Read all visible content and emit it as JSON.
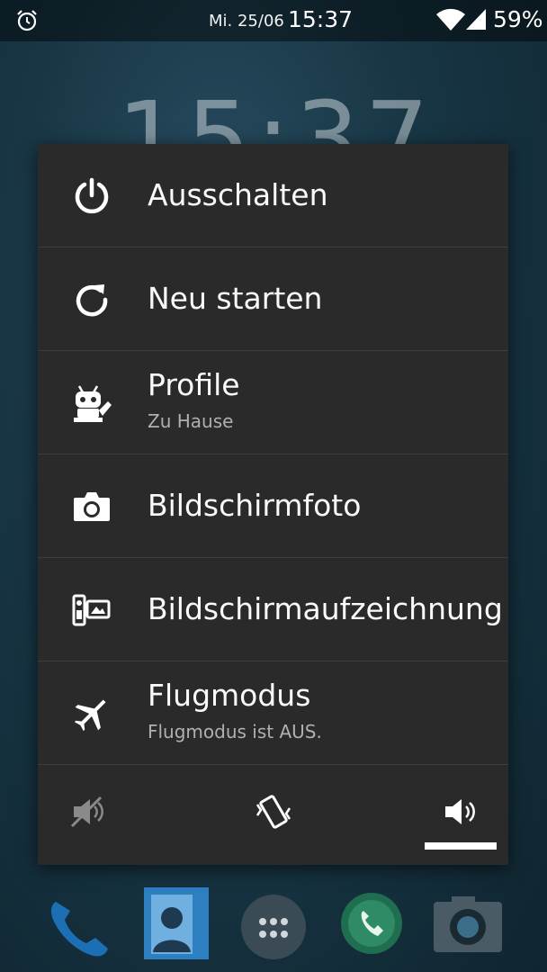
{
  "status_bar": {
    "date": "Mi. 25/06",
    "time": "15:37",
    "battery": "59%",
    "icons": [
      "alarm-icon",
      "wifi-icon",
      "signal-icon"
    ]
  },
  "background": {
    "clock": "15:37"
  },
  "power_menu": {
    "items": [
      {
        "icon": "power-icon",
        "title": "Ausschalten"
      },
      {
        "icon": "restart-icon",
        "title": "Neu starten"
      },
      {
        "icon": "cyanogen-mascot-icon",
        "title": "Profile",
        "subtitle": "Zu Hause"
      },
      {
        "icon": "camera-icon",
        "title": "Bildschirmfoto"
      },
      {
        "icon": "screen-record-icon",
        "title": "Bildschirmaufzeichnung"
      },
      {
        "icon": "airplane-icon",
        "title": "Flugmodus",
        "subtitle": "Flugmodus ist AUS."
      }
    ],
    "sound_modes": [
      {
        "icon": "sound-muted-icon",
        "selected": false
      },
      {
        "icon": "vibrate-icon",
        "selected": false
      },
      {
        "icon": "sound-on-icon",
        "selected": true
      }
    ]
  },
  "dock": {
    "icons": [
      "phone-icon",
      "contacts-icon",
      "app-drawer-icon",
      "whatsapp-icon",
      "camera-app-icon"
    ]
  },
  "colors": {
    "menu_bg": "#2a2a2a",
    "divider": "#3d3d3d",
    "text_primary": "#fafafa",
    "text_secondary": "#b0b0b0"
  }
}
